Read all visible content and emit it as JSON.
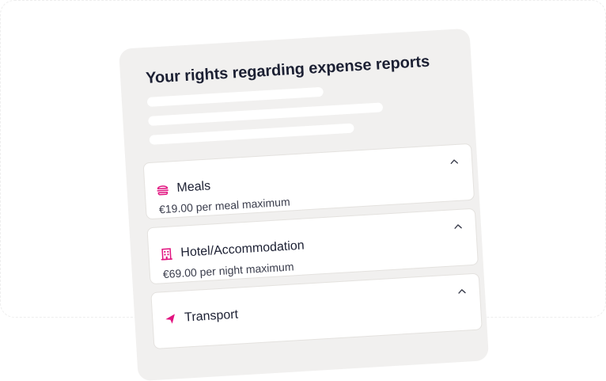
{
  "panel": {
    "title": "Your rights regarding expense reports",
    "items": [
      {
        "icon": "burger-icon",
        "label": "Meals",
        "detail": "€19.00 per meal maximum"
      },
      {
        "icon": "building-icon",
        "label": "Hotel/Accommodation",
        "detail": "€69.00 per night maximum"
      },
      {
        "icon": "transport-icon",
        "label": "Transport",
        "detail": ""
      }
    ]
  },
  "colors": {
    "accent": "#e1127f",
    "panel_bg": "#f1f0ef",
    "text": "#1c2033"
  }
}
